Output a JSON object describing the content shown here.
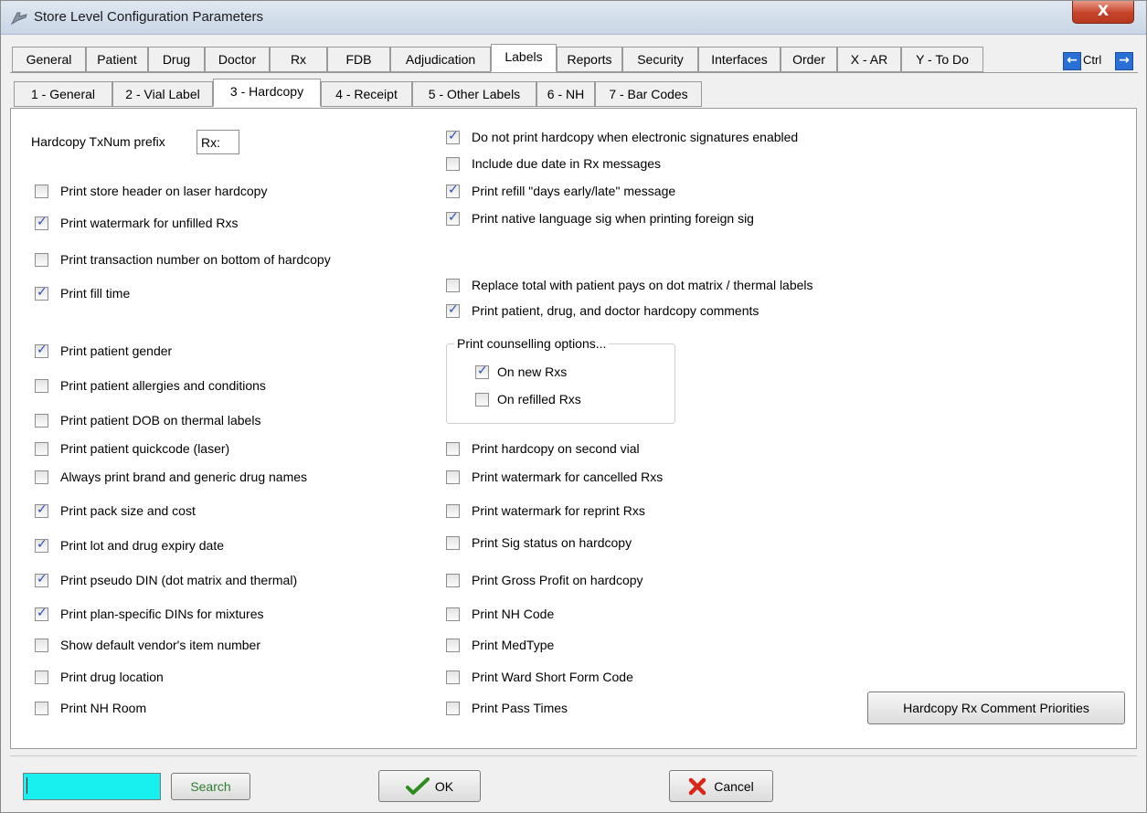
{
  "window": {
    "title": "Store Level Configuration Parameters",
    "close_glyph": "X"
  },
  "tabs_main": [
    {
      "label": "General"
    },
    {
      "label": "Patient"
    },
    {
      "label": "Drug"
    },
    {
      "label": "Doctor"
    },
    {
      "label": "Rx"
    },
    {
      "label": "FDB"
    },
    {
      "label": "Adjudication"
    },
    {
      "label": "Labels",
      "active": true
    },
    {
      "label": "Reports"
    },
    {
      "label": "Security"
    },
    {
      "label": "Interfaces"
    },
    {
      "label": "Order"
    },
    {
      "label": "X - AR"
    },
    {
      "label": "Y - To Do"
    }
  ],
  "nav": {
    "ctrl_label": "Ctrl",
    "left_arrow": "left-arrow-icon",
    "right_arrow": "right-arrow-icon"
  },
  "tabs_sub": [
    {
      "label": "1 - General"
    },
    {
      "label": "2 - Vial Label"
    },
    {
      "label": "3 - Hardcopy",
      "active": true
    },
    {
      "label": "4 - Receipt"
    },
    {
      "label": "5 - Other Labels"
    },
    {
      "label": "6 - NH"
    },
    {
      "label": "7 - Bar Codes"
    }
  ],
  "hardcopy": {
    "prefix_label": "Hardcopy TxNum prefix",
    "prefix_value": "Rx:",
    "left_options": [
      {
        "label": "Print store header on laser hardcopy",
        "checked": false
      },
      {
        "label": "Print watermark for unfilled Rxs",
        "checked": true
      },
      {
        "label": "Print transaction number on bottom of hardcopy",
        "checked": false
      },
      {
        "label": "Print fill time",
        "checked": true
      },
      {
        "label": "Print patient gender",
        "checked": true
      },
      {
        "label": "Print patient allergies and conditions",
        "checked": false
      },
      {
        "label": "Print patient DOB on thermal labels",
        "checked": false
      },
      {
        "label": "Print patient quickcode (laser)",
        "checked": false
      },
      {
        "label": "Always print brand and generic drug names",
        "checked": false
      },
      {
        "label": "Print pack size and cost",
        "checked": true
      },
      {
        "label": "Print lot and drug expiry date",
        "checked": true
      },
      {
        "label": "Print pseudo DIN (dot matrix and thermal)",
        "checked": true
      },
      {
        "label": "Print plan-specific DINs for mixtures",
        "checked": true
      },
      {
        "label": "Show default vendor's item number",
        "checked": false
      },
      {
        "label": "Print drug location",
        "checked": false
      },
      {
        "label": "Print NH Room",
        "checked": false
      }
    ],
    "right_options": [
      {
        "label": "Do not print hardcopy when electronic signatures enabled",
        "checked": true
      },
      {
        "label": "Include due date in Rx messages",
        "checked": false
      },
      {
        "label": "Print refill \"days early/late\" message",
        "checked": true
      },
      {
        "label": "Print native language sig when printing foreign sig",
        "checked": true
      },
      {
        "label": "Replace total with patient pays on dot matrix / thermal labels",
        "checked": false
      },
      {
        "label": "Print patient, drug, and doctor hardcopy comments",
        "checked": true
      },
      {
        "label": "Print hardcopy on second vial",
        "checked": false
      },
      {
        "label": "Print watermark for cancelled Rxs",
        "checked": false
      },
      {
        "label": "Print watermark for reprint Rxs",
        "checked": false
      },
      {
        "label": "Print Sig status on hardcopy",
        "checked": false
      },
      {
        "label": "Print Gross Profit on hardcopy",
        "checked": false
      },
      {
        "label": "Print NH Code",
        "checked": false
      },
      {
        "label": "Print MedType",
        "checked": false
      },
      {
        "label": "Print Ward Short Form Code",
        "checked": false
      },
      {
        "label": "Print Pass Times",
        "checked": false
      }
    ],
    "counselling": {
      "title": "Print counselling options...",
      "options": [
        {
          "label": "On new Rxs",
          "checked": true
        },
        {
          "label": "On refilled Rxs",
          "checked": false
        }
      ]
    },
    "priorities_button": "Hardcopy Rx Comment Priorities"
  },
  "footer": {
    "search_value": "",
    "search_button": "Search",
    "ok_button": "OK",
    "cancel_button": "Cancel"
  },
  "colors": {
    "checkmark": "#2a4fb3",
    "search_field": "#18f0f0",
    "ok_icon": "#2e8b1f",
    "cancel_icon": "#d8261b",
    "search_text": "#2e7d2e"
  }
}
